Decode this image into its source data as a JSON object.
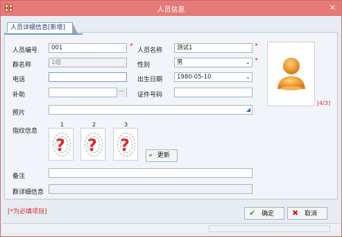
{
  "window": {
    "title": "人员信息",
    "close": "×"
  },
  "tab": {
    "label": "人员详细信息[新增]"
  },
  "form": {
    "person_no_label": "人员编号",
    "person_no_value": "001",
    "person_name_label": "人员名称",
    "person_name_value": "测试1",
    "group_name_label": "群名称",
    "group_name_value": "1组",
    "gender_label": "性别",
    "gender_value": "男",
    "phone_label": "电话",
    "phone_value": "",
    "birth_label": "出生日期",
    "birth_value": "1980-05-10",
    "subsidy_label": "补助",
    "subsidy_value": "",
    "id_label": "证件号码",
    "id_value": "",
    "photo_label": "照片",
    "photo_value": "",
    "fingerprint_label": "指纹信息",
    "fingerprints": [
      "1",
      "2",
      "3"
    ],
    "update_label": "更新",
    "remark_label": "备注",
    "remark_value": "",
    "group_detail_label": "群详细信息",
    "group_detail_value": ""
  },
  "photo": {
    "count": "[4/3]"
  },
  "required_note": "[*为必填项目]",
  "required_mark": "*",
  "fingerprint_placeholder": "?",
  "buttons": {
    "ok": "确定",
    "cancel": "取消"
  },
  "colors": {
    "titlebar": "#e57a78",
    "required": "#d62929",
    "ok_icon": "#2e9a2e",
    "cancel_icon": "#d21f1f"
  }
}
